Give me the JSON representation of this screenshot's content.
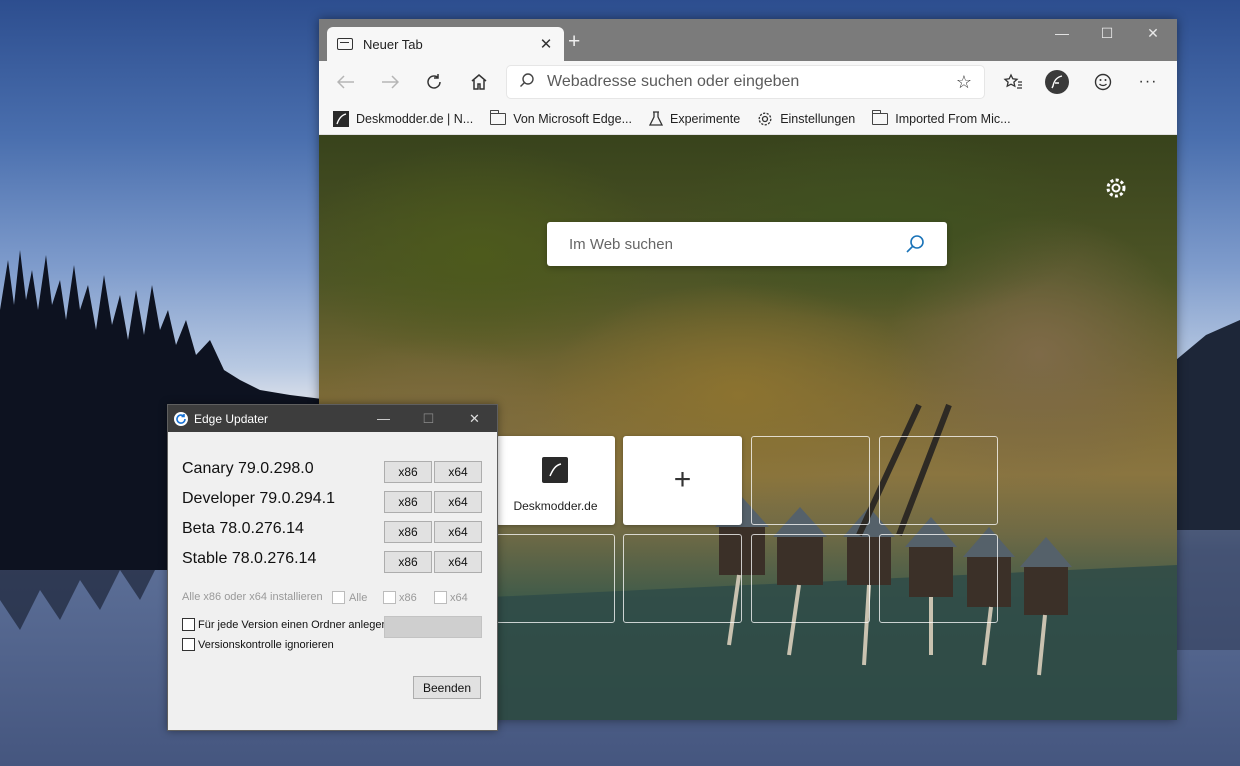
{
  "browser": {
    "tab": {
      "title": "Neuer Tab",
      "close": "✕",
      "icon": "new-tab-page-icon"
    },
    "new_tab": "+",
    "window_controls": {
      "minimize": "—",
      "maximize": "☐",
      "close": "✕"
    },
    "address_bar": {
      "placeholder": "Webadresse suchen oder eingeben"
    },
    "favorites": [
      {
        "label": "Deskmodder.de | N...",
        "icon": "deskmodder-icon"
      },
      {
        "label": "Von Microsoft Edge...",
        "icon": "folder-icon"
      },
      {
        "label": "Experimente",
        "icon": "flask-icon"
      },
      {
        "label": "Einstellungen",
        "icon": "gear-icon"
      },
      {
        "label": "Imported From Mic...",
        "icon": "folder-icon"
      }
    ],
    "new_tab_page": {
      "search_placeholder": "Im Web suchen",
      "tiles": [
        {
          "label": "Deskmodder.de"
        }
      ],
      "add_tile": "+"
    }
  },
  "updater": {
    "title": "Edge Updater",
    "controls": {
      "minimize": "—",
      "maximize": "☐",
      "close": "✕"
    },
    "versions": [
      {
        "name": "Canary 79.0.298.0",
        "x86": "x86",
        "x64": "x64"
      },
      {
        "name": "Developer 79.0.294.1",
        "x86": "x86",
        "x64": "x64"
      },
      {
        "name": "Beta 78.0.276.14",
        "x86": "x86",
        "x64": "x64"
      },
      {
        "name": "Stable 78.0.276.14",
        "x86": "x86",
        "x64": "x64"
      }
    ],
    "install_all_label": "Alle x86 oder x64 installieren",
    "opt_all": "Alle",
    "opt_x86": "x86",
    "opt_x64": "x64",
    "folder_checkbox": "Für jede Version einen Ordner anlegen",
    "ignore_checkbox": "Versionskontrolle ignorieren",
    "exit_button": "Beenden"
  }
}
